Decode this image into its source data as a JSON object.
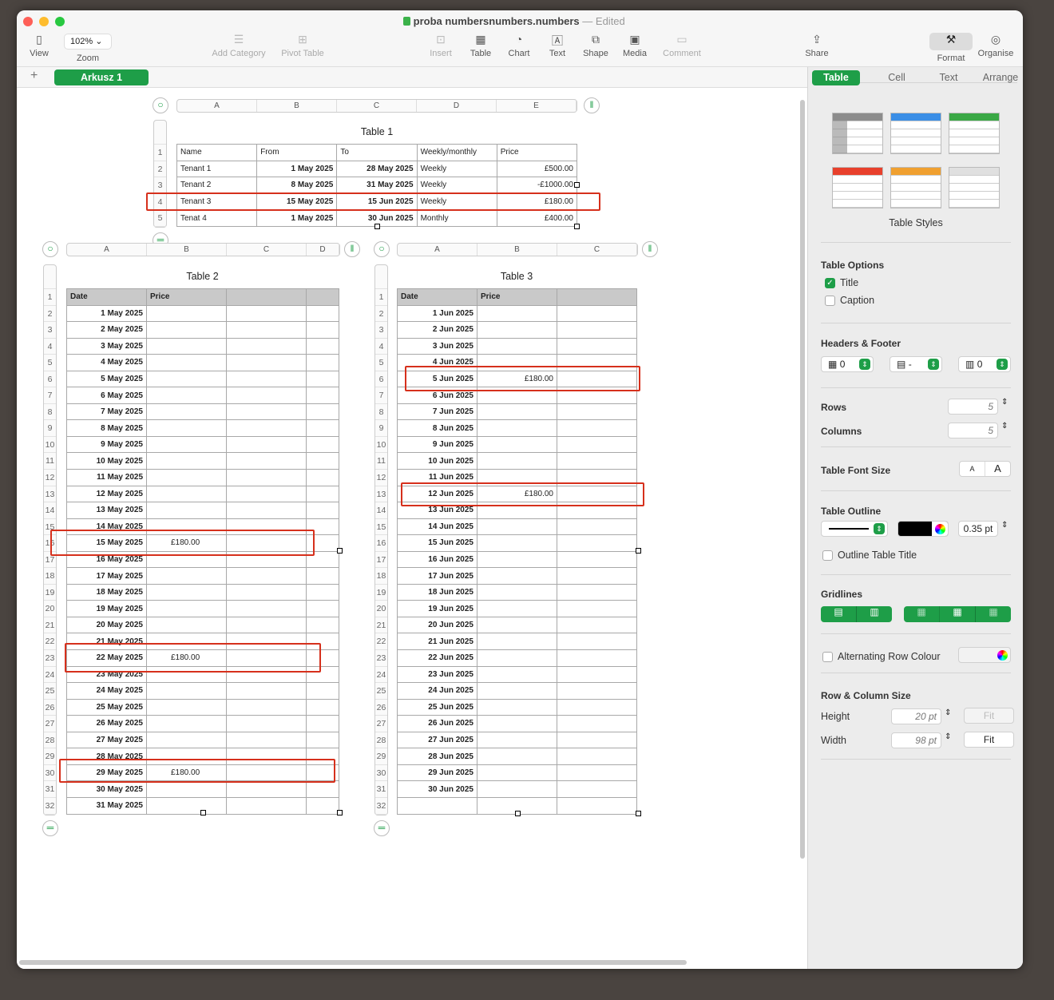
{
  "window": {
    "title": "proba numbersnumbers.numbers",
    "status": "— Edited"
  },
  "toolbar": {
    "items": [
      {
        "label": "View",
        "icon": "sidebar-icon"
      },
      {
        "label": "Zoom",
        "value": "102%"
      },
      {
        "label": "Add Category",
        "icon": "list-icon",
        "disabled": true
      },
      {
        "label": "Pivot Table",
        "icon": "pivot-icon",
        "disabled": true
      },
      {
        "label": "Insert",
        "icon": "insert-icon",
        "disabled": true
      },
      {
        "label": "Table",
        "icon": "table-icon"
      },
      {
        "label": "Chart",
        "icon": "chart-icon"
      },
      {
        "label": "Text",
        "icon": "text-icon"
      },
      {
        "label": "Shape",
        "icon": "shape-icon"
      },
      {
        "label": "Media",
        "icon": "media-icon"
      },
      {
        "label": "Comment",
        "icon": "comment-icon",
        "disabled": true
      },
      {
        "label": "Share",
        "icon": "share-icon"
      },
      {
        "label": "Format",
        "icon": "brush-icon"
      },
      {
        "label": "Organise",
        "icon": "organise-icon"
      }
    ]
  },
  "sheets": {
    "add": "+",
    "active": "Arkusz 1"
  },
  "tables": {
    "t1": {
      "title": "Table 1",
      "columns": [
        "A",
        "B",
        "C",
        "D",
        "E"
      ],
      "rows": [
        [
          "Name",
          "From",
          "To",
          "Weekly/monthly",
          "Price"
        ],
        [
          "Tenant 1",
          "1 May 2025",
          "28 May 2025",
          "Weekly",
          "£500.00"
        ],
        [
          "Tenant 2",
          "8 May 2025",
          "31 May 2025",
          "Weekly",
          "-£1000.00"
        ],
        [
          "Tenant 3",
          "15 May 2025",
          "15 Jun 2025",
          "Weekly",
          "£180.00"
        ],
        [
          "Tenat 4",
          "1 May 2025",
          "30 Jun 2025",
          "Monthly",
          "£400.00"
        ]
      ]
    },
    "t2": {
      "title": "Table 2",
      "columns": [
        "A",
        "B",
        "C",
        "D"
      ],
      "header": [
        "Date",
        "Price"
      ],
      "dates": [
        "1 May 2025",
        "2 May 2025",
        "3 May 2025",
        "4 May 2025",
        "5 May 2025",
        "6 May 2025",
        "7 May 2025",
        "8 May 2025",
        "9 May 2025",
        "10 May 2025",
        "11 May 2025",
        "12 May 2025",
        "13 May 2025",
        "14 May 2025",
        "15 May 2025",
        "16 May 2025",
        "17 May 2025",
        "18 May 2025",
        "19 May 2025",
        "20 May 2025",
        "21 May 2025",
        "22 May 2025",
        "23 May 2025",
        "24 May 2025",
        "25 May 2025",
        "26 May 2025",
        "27 May 2025",
        "28 May 2025",
        "29 May 2025",
        "30 May 2025",
        "31 May 2025"
      ],
      "prices": {
        "15 May 2025": "£180.00",
        "22 May 2025": "£180.00",
        "29 May 2025": "£180.00"
      }
    },
    "t3": {
      "title": "Table 3",
      "columns": [
        "A",
        "B",
        "C"
      ],
      "header": [
        "Date",
        "Price"
      ],
      "dates": [
        "1 Jun 2025",
        "2 Jun 2025",
        "3 Jun 2025",
        "4 Jun 2025",
        "5 Jun 2025",
        "6 Jun 2025",
        "7 Jun 2025",
        "8 Jun 2025",
        "9 Jun 2025",
        "10 Jun 2025",
        "11 Jun 2025",
        "12 Jun 2025",
        "13 Jun 2025",
        "14 Jun 2025",
        "15 Jun 2025",
        "16 Jun 2025",
        "17 Jun 2025",
        "18 Jun 2025",
        "19 Jun 2025",
        "20 Jun 2025",
        "21 Jun 2025",
        "22 Jun 2025",
        "23 Jun 2025",
        "24 Jun 2025",
        "25 Jun 2025",
        "26 Jun 2025",
        "27 Jun 2025",
        "28 Jun 2025",
        "29 Jun 2025",
        "30 Jun 2025",
        ""
      ],
      "prices": {
        "5 Jun 2025": "£180.00",
        "12 Jun 2025": "£180.00"
      }
    }
  },
  "inspector": {
    "tabs": [
      "Table",
      "Cell",
      "Text",
      "Arrange"
    ],
    "styles_label": "Table Styles",
    "style_colors": [
      "#8c8c8c",
      "#3a8ee6",
      "#3aa845",
      "#e8402c",
      "#f0a030",
      "#e0e0e0"
    ],
    "options": {
      "heading": "Table Options",
      "title": "Title",
      "title_checked": true,
      "caption": "Caption",
      "caption_checked": false
    },
    "headers": {
      "heading": "Header & Footer",
      "heading_text": "Headers & Footer",
      "header_rows": "0",
      "header_cols": "-",
      "footer_rows": "0"
    },
    "rows_label": "Rows",
    "rows": "5",
    "cols_label": "Columns",
    "cols": "5",
    "font_size": {
      "label": "Table Font Size",
      "small": "A",
      "large": "A"
    },
    "outline": {
      "label": "Table Outline",
      "color": "#000000",
      "width": "0.35 pt",
      "title_label": "Outline Table Title"
    },
    "gridlines_label": "Gridlines",
    "alt_row": "Alternating Row Colour",
    "size": {
      "heading": "Row & Column Size",
      "height_label": "Height",
      "height": "20 pt",
      "width_label": "Width",
      "width": "98 pt",
      "fit": "Fit"
    }
  }
}
